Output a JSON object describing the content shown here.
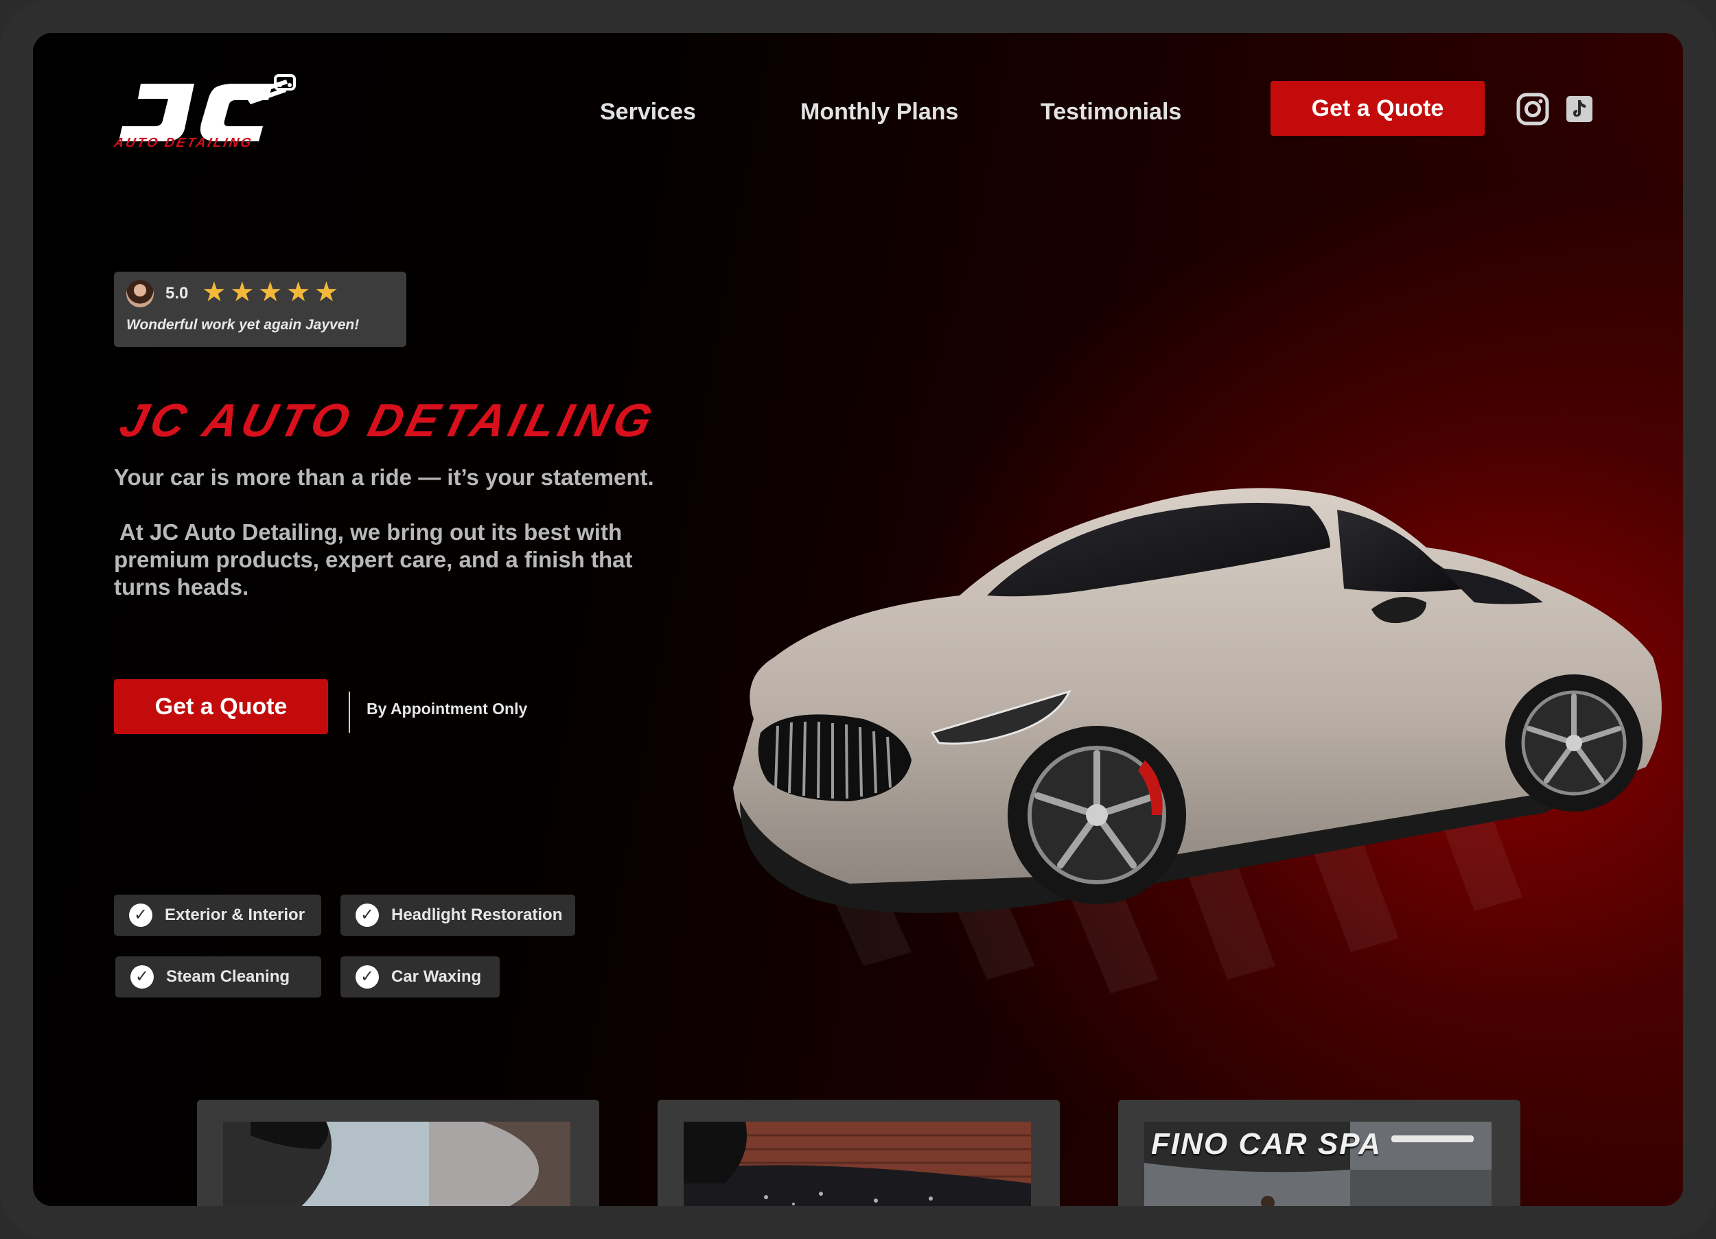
{
  "brand": {
    "logo_mark": "JC",
    "logo_sub": "AUTO DETAILING"
  },
  "nav": {
    "links": [
      "Services",
      "Monthly Plans",
      "Testimonials"
    ],
    "quote_label": "Get a Quote",
    "icons": [
      "instagram-icon",
      "tiktok-icon"
    ]
  },
  "review": {
    "rating": "5.0",
    "stars": 5,
    "text": "Wonderful work yet again Jayven!"
  },
  "hero": {
    "title": "JC AUTO DETAILING",
    "tagline": "Your car is more than a ride — it’s your statement.",
    "body": "At JC Auto Detailing, we bring out its best with premium products, expert care, and a finish that turns heads.",
    "quote_label": "Get a Quote",
    "appointment": "By Appointment Only"
  },
  "features": [
    "Exterior & Interior",
    "Headlight Restoration",
    "Steam Cleaning",
    "Car Waxing"
  ],
  "cards": {
    "third_sign": "FINO CAR SPA"
  },
  "colors": {
    "accent": "#c40b0b",
    "title_red": "#d8101b",
    "star": "#f4b93a",
    "card_bg": "#3a3a3a"
  }
}
